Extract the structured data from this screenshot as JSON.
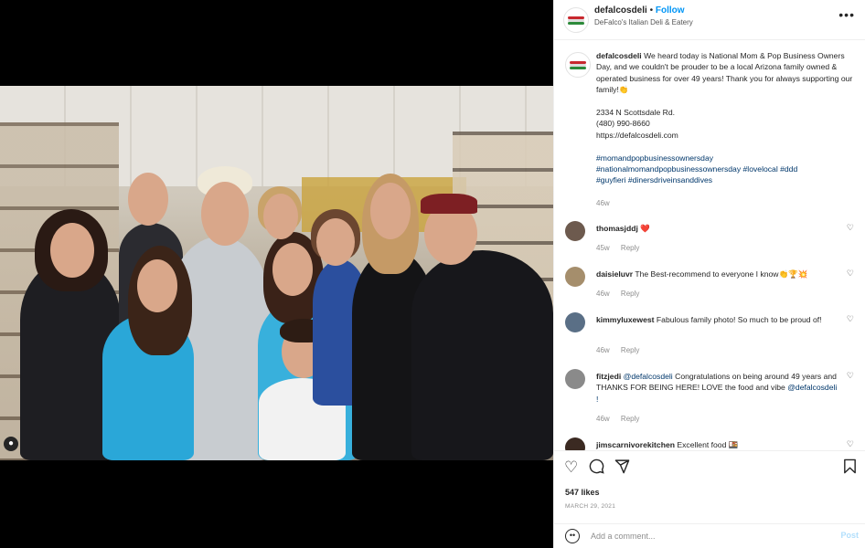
{
  "post": {
    "username": "defalcosdeli",
    "dot": "•",
    "follow": "Follow",
    "location": "DeFalco's Italian Deli & Eatery",
    "more": "•••"
  },
  "caption": {
    "username": "defalcosdeli",
    "text": "We heard today is National Mom & Pop Business Owners Day, and we couldn't be prouder to be a local Arizona family owned & operated business for over 49 years! Thank you for always supporting our family!👏",
    "address": "2334 N Scottsdale Rd.",
    "phone": "(480) 990-8660",
    "website": "https://defalcosdeli.com",
    "hashtags_line1": "#momandpopbusinessownersday",
    "hashtags_line2": "#nationalmomandpopbusinessownersday #lovelocal #ddd",
    "hashtags_line3": "#guyfieri #dinersdriveinsanddives",
    "time": "46w"
  },
  "comments": [
    {
      "username": "thomasjddj",
      "text": "❤️",
      "time": "45w",
      "reply": "Reply",
      "avatar_color": "#6d5a4e"
    },
    {
      "username": "daisieluvr",
      "text": "The Best-recommend to everyone I know👏🏆💥",
      "time": "46w",
      "reply": "Reply",
      "avatar_color": "#a58e6c"
    },
    {
      "username": "kimmyluxewest",
      "text": "Fabulous family photo! So much to be proud of!",
      "time": "46w",
      "reply": "Reply",
      "avatar_color": "#5a6f86"
    },
    {
      "username": "fitzjedi",
      "text_prefix": "@defalcosdeli",
      "text": "Congratulations on being around 49 years and THANKS FOR BEING HERE! LOVE the food and vibe",
      "text_suffix": "@defalcosdeli !",
      "time": "46w",
      "reply": "Reply",
      "avatar_color": "#8a8a8a"
    },
    {
      "username": "jimscarnivorekitchen",
      "text": "Excellent food 🍱",
      "avatar_color": "#3b2a22"
    }
  ],
  "actions": {
    "like_icon": "heart-icon",
    "comment_icon": "comment-icon",
    "share_icon": "share-icon",
    "save_icon": "bookmark-icon",
    "likes": "547 likes",
    "date": "MARCH 29, 2021"
  },
  "add_comment": {
    "placeholder": "Add a comment...",
    "post": "Post"
  },
  "colors": {
    "link": "#00376b",
    "follow": "#0095f6",
    "post_disabled": "#b2dffc"
  }
}
